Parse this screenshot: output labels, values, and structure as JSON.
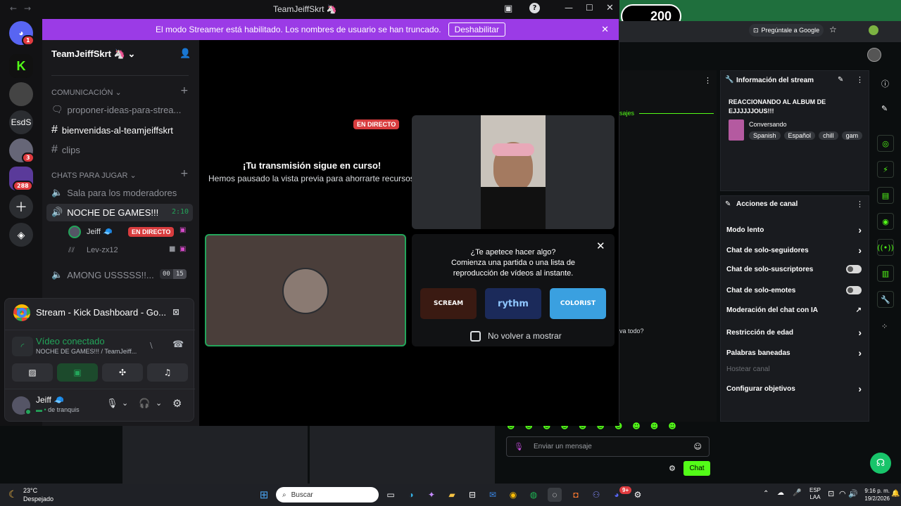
{
  "counter": "200",
  "browser": {
    "ask_google": "Pregúntale a Google"
  },
  "window": {
    "title": "TeamJeiffSkrt 🦄"
  },
  "banner": {
    "text": "El modo Streamer está habilitado. Los nombres de usuario se han truncado.",
    "button": "Deshabilitar"
  },
  "rail": {
    "dm_badge": "1",
    "server_badge_3": "3",
    "server_badge_288": "288",
    "esds": "EsdS"
  },
  "server": {
    "name": "TeamJeiffSkrt 🦄"
  },
  "channels": {
    "cat1": "COMUNICACIÓN",
    "proponer": "proponer-ideas-para-strea...",
    "bienvenidas": "bienvenidas-al-teamjeiffskrt",
    "clips": "clips",
    "cat2": "CHATS PARA JUGAR",
    "sala": "Sala para los moderadores",
    "noche": "NOCHE DE GAMES!!!",
    "noche_time": "2:10",
    "user1": "Jeiff 🧢",
    "live": "EN DIRECTO",
    "user2": "Lev-zx12",
    "among": "AMONG USSSSS!!...",
    "among_a": "00",
    "among_b": "15"
  },
  "panel": {
    "stream_title": "Stream - Kick Dashboard - Go...",
    "status": "Vídeo conectado",
    "sub": "NOCHE DE GAMES!!! / TeamJeiff...",
    "user": "Jeiff 🧢",
    "user_status": "de tranquis"
  },
  "stage": {
    "live": "EN DIRECTO",
    "heading": "¡Tu transmisión sigue en curso!",
    "sub": "Hemos pausado la vista previa para ahorrarte recursos.",
    "activity_q": "¿Te apetece hacer algo?",
    "activity_line1": "Comienza una partida o una lista de",
    "activity_line2": "reproducción de vídeos al instante.",
    "checkbox": "No volver a mostrar",
    "game1": "SCREAM",
    "game2": "rythm",
    "game3": "COLORIST"
  },
  "kick": {
    "mensajes": "sajes",
    "stream_info_title": "Información del stream",
    "stream_title": "REACCIONANDO AL ALBUM DE EJJJJJJOUS!!!",
    "category": "Conversando",
    "tags": [
      "Spanish",
      "Español",
      "chill",
      "gam"
    ],
    "actions_title": "Acciones de canal",
    "actions": [
      "Modo lento",
      "Chat de solo-seguidores",
      "Chat de solo-suscriptores",
      "Chat de solo-emotes",
      "Moderación del chat con IA",
      "Restricción de edad",
      "Palabras baneadas",
      "Hostear canal",
      "Configurar objetivos"
    ],
    "chat_snip": "va todo?",
    "input_placeholder": "Enviar un mensaje",
    "chat_button": "Chat"
  },
  "taskbar": {
    "temp": "23°C",
    "weather": "Despejado",
    "search": "Buscar",
    "lang1": "ESP",
    "lang2": "LAA",
    "time": "9:16 p. m.",
    "date": "19/2/2026",
    "badge": "9+"
  }
}
